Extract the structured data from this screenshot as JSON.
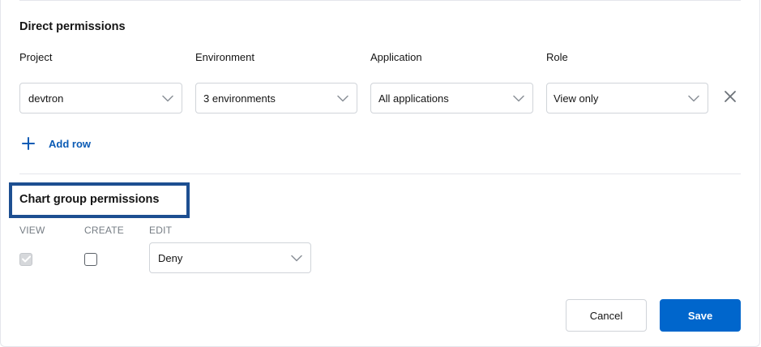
{
  "direct_permissions": {
    "title": "Direct permissions",
    "columns": {
      "project": "Project",
      "environment": "Environment",
      "application": "Application",
      "role": "Role"
    },
    "row": {
      "project": "devtron",
      "environment": "3 environments",
      "application": "All applications",
      "role": "View only"
    },
    "add_row_label": "Add row"
  },
  "chart_group_permissions": {
    "title": "Chart group permissions",
    "labels": {
      "view": "VIEW",
      "create": "CREATE",
      "edit": "EDIT"
    },
    "view_checked": true,
    "create_checked": false,
    "edit_value": "Deny"
  },
  "footer": {
    "cancel_label": "Cancel",
    "save_label": "Save"
  },
  "colors": {
    "accent": "#0066cc",
    "link": "#0b5bb5",
    "highlight_border": "#1d4f91"
  },
  "icons": {
    "dropdown": "chevron-down-icon",
    "remove": "close-icon",
    "add": "plus-icon",
    "check": "check-icon"
  }
}
